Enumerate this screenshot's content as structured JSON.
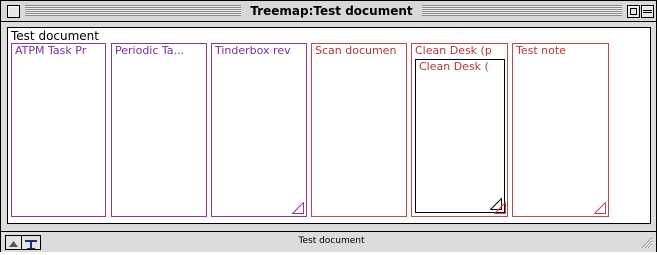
{
  "window": {
    "title": "Treemap:Test document",
    "status_text": "Test document"
  },
  "treemap": {
    "root_title": "Test document",
    "notes": [
      {
        "label": "ATPM Task Pr",
        "color": "#8a38a6"
      },
      {
        "label": "Periodic Ta...",
        "color": "#8a38a6"
      },
      {
        "label": "Tinderbox rev",
        "color": "#8a38a6"
      },
      {
        "label": "Scan documen",
        "color": "#c24a4a"
      },
      {
        "label": "Clean Desk (p",
        "color": "#c24a4a",
        "child_label": "Clean Desk ("
      },
      {
        "label": "Test note",
        "color": "#c24a4a"
      }
    ]
  },
  "icons": {
    "close": "close-box-icon",
    "zoom": "zoom-box-icon",
    "collapse": "collapse-box-icon",
    "home": "home-arrow-icon",
    "monitor": "monitor-icon",
    "resize": "resize-grip-icon"
  }
}
